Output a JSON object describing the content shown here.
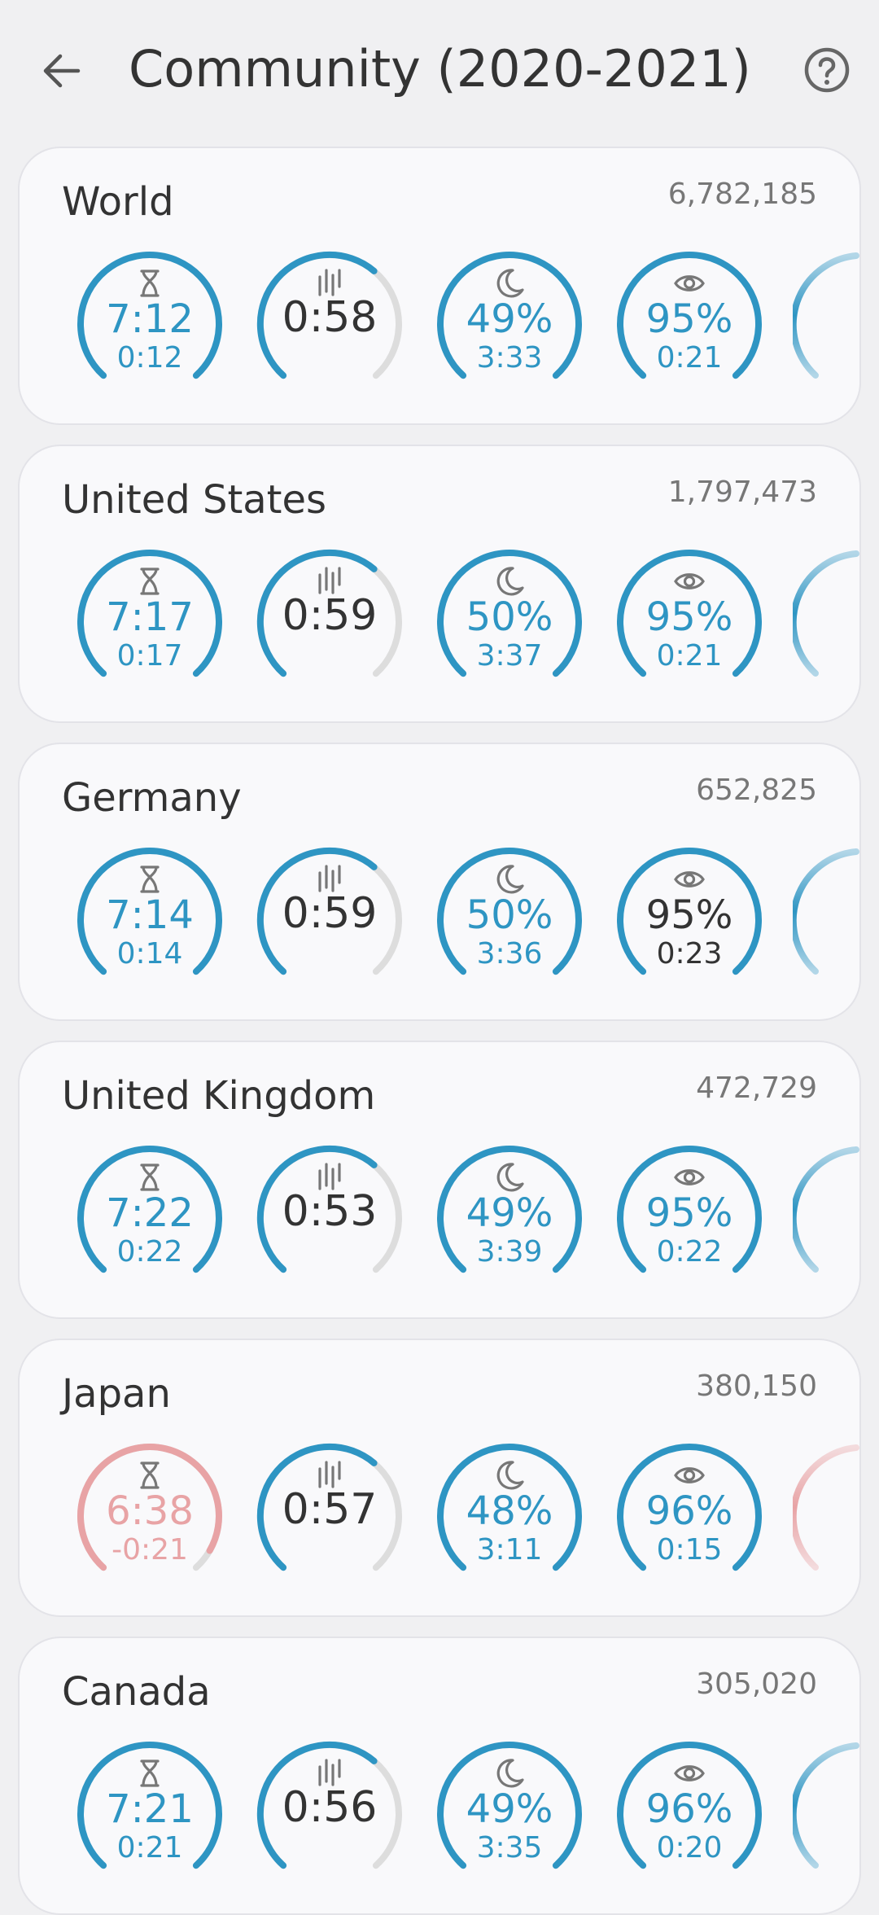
{
  "app_bar": {
    "title": "Community (2020-2021)",
    "back_icon": "arrow-left-icon",
    "help_icon": "question-circle-icon"
  },
  "colors": {
    "accent": "#2e95c3",
    "negative": "#e8a3a5",
    "track": "#dddddd",
    "neutral_text": "#333333"
  },
  "countries": [
    {
      "name": "World",
      "count": "6,782,185",
      "negative": false,
      "sleep_time": "7:12",
      "sleep_diff": "0:12",
      "variation": "0:58",
      "deep_percent": "49%",
      "deep_time": "3:33",
      "deep_highlight": true,
      "awake_percent": "95%",
      "awake_time": "0:21",
      "awake_highlight": true
    },
    {
      "name": "United States",
      "count": "1,797,473",
      "negative": false,
      "sleep_time": "7:17",
      "sleep_diff": "0:17",
      "variation": "0:59",
      "deep_percent": "50%",
      "deep_time": "3:37",
      "deep_highlight": true,
      "awake_percent": "95%",
      "awake_time": "0:21",
      "awake_highlight": true
    },
    {
      "name": "Germany",
      "count": "652,825",
      "negative": false,
      "sleep_time": "7:14",
      "sleep_diff": "0:14",
      "variation": "0:59",
      "deep_percent": "50%",
      "deep_time": "3:36",
      "deep_highlight": true,
      "awake_percent": "95%",
      "awake_time": "0:23",
      "awake_highlight": false
    },
    {
      "name": "United Kingdom",
      "count": "472,729",
      "negative": false,
      "sleep_time": "7:22",
      "sleep_diff": "0:22",
      "variation": "0:53",
      "deep_percent": "49%",
      "deep_time": "3:39",
      "deep_highlight": true,
      "awake_percent": "95%",
      "awake_time": "0:22",
      "awake_highlight": true
    },
    {
      "name": "Japan",
      "count": "380,150",
      "negative": true,
      "sleep_time": "6:38",
      "sleep_diff": "-0:21",
      "variation": "0:57",
      "deep_percent": "48%",
      "deep_time": "3:11",
      "deep_highlight": true,
      "awake_percent": "96%",
      "awake_time": "0:15",
      "awake_highlight": true
    },
    {
      "name": "Canada",
      "count": "305,020",
      "negative": false,
      "sleep_time": "7:21",
      "sleep_diff": "0:21",
      "variation": "0:56",
      "deep_percent": "49%",
      "deep_time": "3:35",
      "deep_highlight": true,
      "awake_percent": "96%",
      "awake_time": "0:20",
      "awake_highlight": true
    }
  ],
  "gauge_icons": [
    "hourglass-icon",
    "bars-icon",
    "moon-icon",
    "eye-icon"
  ]
}
